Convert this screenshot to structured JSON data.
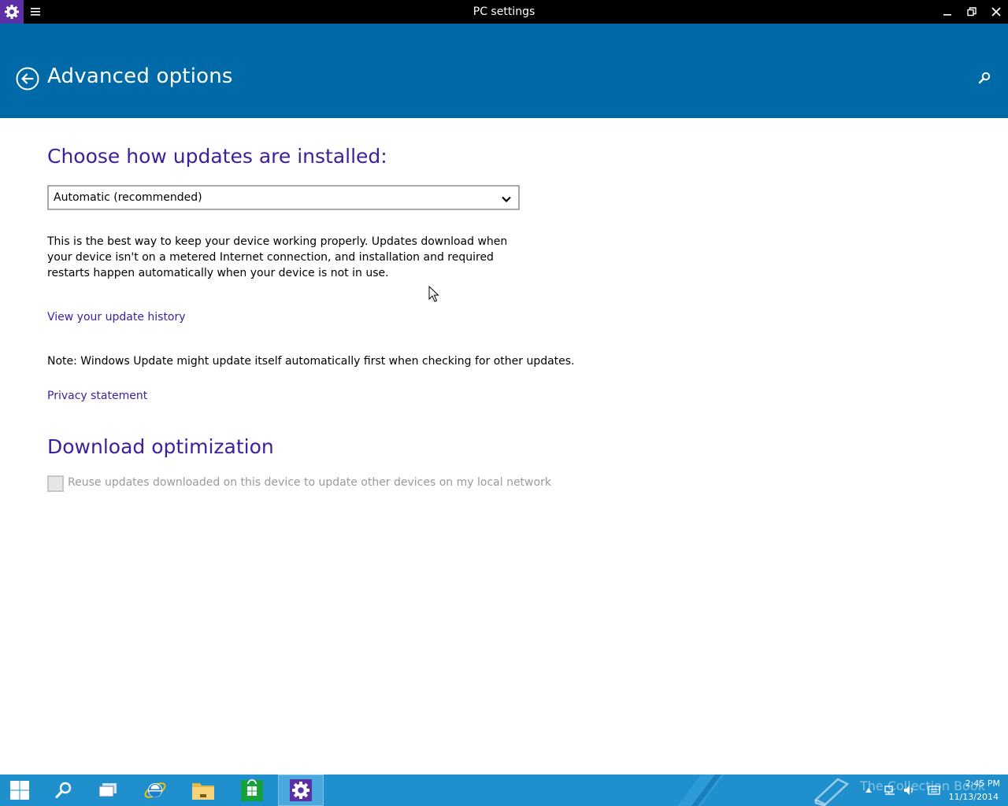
{
  "window": {
    "title": "PC settings",
    "app_icon": "gear-icon",
    "menu_icon": "hamburger-icon",
    "controls": [
      "minimize-icon",
      "restore-icon",
      "close-icon"
    ]
  },
  "header": {
    "title": "Advanced options",
    "back_icon": "back-arrow-icon",
    "search_icon": "search-icon",
    "background_color": "#006aa8"
  },
  "updates": {
    "heading": "Choose how updates are installed:",
    "dropdown_value": "Automatic (recommended)",
    "description": "This is the best way to keep your device working properly. Updates download when your device isn't on a metered Internet connection, and installation and required restarts happen automatically when your device is not in use.",
    "history_link": "View your update history",
    "note": "Note: Windows Update might update itself automatically first when checking for other updates.",
    "privacy_link": "Privacy statement"
  },
  "download_optimization": {
    "heading": "Download optimization",
    "checkbox_label": "Reuse updates downloaded on this device to update other devices on my local network",
    "checked": false,
    "enabled": false
  },
  "taskbar": {
    "items": [
      {
        "name": "start-button",
        "icon": "windows-logo-icon"
      },
      {
        "name": "search-button",
        "icon": "search-icon"
      },
      {
        "name": "task-view-button",
        "icon": "task-view-icon"
      },
      {
        "name": "internet-explorer-button",
        "icon": "internet-explorer-icon"
      },
      {
        "name": "file-explorer-button",
        "icon": "folder-icon"
      },
      {
        "name": "store-button",
        "icon": "store-icon"
      },
      {
        "name": "pc-settings-button",
        "icon": "gear-icon",
        "active": true
      }
    ],
    "watermark": "The Collection Book",
    "time": "2:45 PM",
    "date": "11/13/2014",
    "color": "#1f90cd"
  },
  "colors": {
    "accent_text": "#3b1f9c",
    "titlebar": "#000000",
    "app_icon_bg": "#5b2fa5"
  }
}
